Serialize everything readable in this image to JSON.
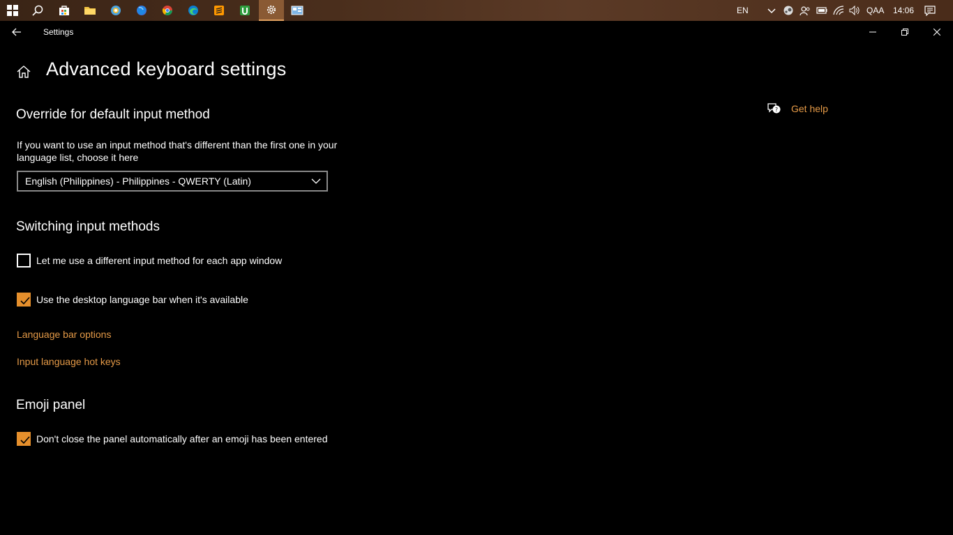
{
  "taskbar": {
    "apps": [
      {
        "name": "start-button-icon"
      },
      {
        "name": "search-icon"
      },
      {
        "name": "store-icon"
      },
      {
        "name": "file-explorer-icon"
      },
      {
        "name": "browser-icon"
      },
      {
        "name": "firefox-icon"
      },
      {
        "name": "chrome-icon"
      },
      {
        "name": "edge-icon"
      },
      {
        "name": "sublime-icon"
      },
      {
        "name": "green-app-icon"
      },
      {
        "name": "settings-gear-icon",
        "active": true
      },
      {
        "name": "control-panel-icon"
      }
    ],
    "tray": {
      "language": "EN",
      "input": "QAA",
      "time": "14:06"
    }
  },
  "window": {
    "title": "Settings"
  },
  "page": {
    "title": "Advanced keyboard settings",
    "help_label": "Get help",
    "override_section": {
      "title": "Override for default input method",
      "description": "If you want to use an input method that's different than the first one in your language list, choose it here",
      "dropdown_value": "English (Philippines) - Philippines - QWERTY (Latin)"
    },
    "switching_section": {
      "title": "Switching input methods",
      "options": [
        {
          "label": "Let me use a different input method for each app window",
          "checked": false
        },
        {
          "label": "Use the desktop language bar when it's available",
          "checked": true
        }
      ],
      "links": [
        "Language bar options",
        "Input language hot keys"
      ]
    },
    "emoji_section": {
      "title": "Emoji panel",
      "options": [
        {
          "label": "Don't close the panel automatically after an emoji has been entered",
          "checked": true
        }
      ]
    }
  },
  "colors": {
    "accent": "#e58f2c",
    "link": "#e59a47",
    "background": "#000000"
  }
}
